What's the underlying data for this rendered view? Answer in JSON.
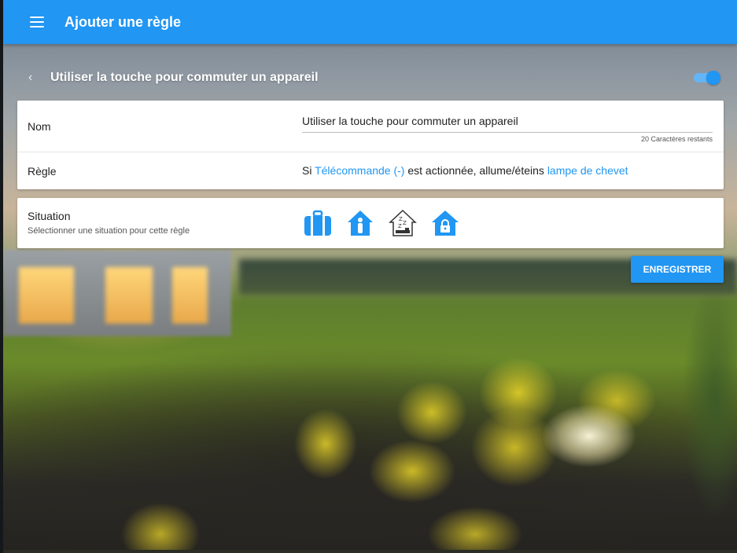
{
  "appbar": {
    "title": "Ajouter une règle",
    "color": "#2196f3"
  },
  "subheader": {
    "title": "Utiliser la touche pour commuter un appareil",
    "enabled": true
  },
  "form": {
    "name": {
      "label": "Nom",
      "value": "Utiliser la touche pour commuter un appareil",
      "remaining": "20 Caractères restants"
    },
    "rule": {
      "label": "Règle",
      "prefix": "Si ",
      "trigger_link": "Télécommande (-)",
      "middle": " est actionnée, allume/éteins ",
      "device_link": "lampe de chevet"
    },
    "situation": {
      "title": "Situation",
      "subtitle": "Sélectionner une situation pour cette règle",
      "icons": [
        "suitcase-icon",
        "person-at-home-icon",
        "sleep-zzz-icon",
        "lock-home-icon"
      ]
    }
  },
  "actions": {
    "save_label": "ENREGISTRER"
  }
}
